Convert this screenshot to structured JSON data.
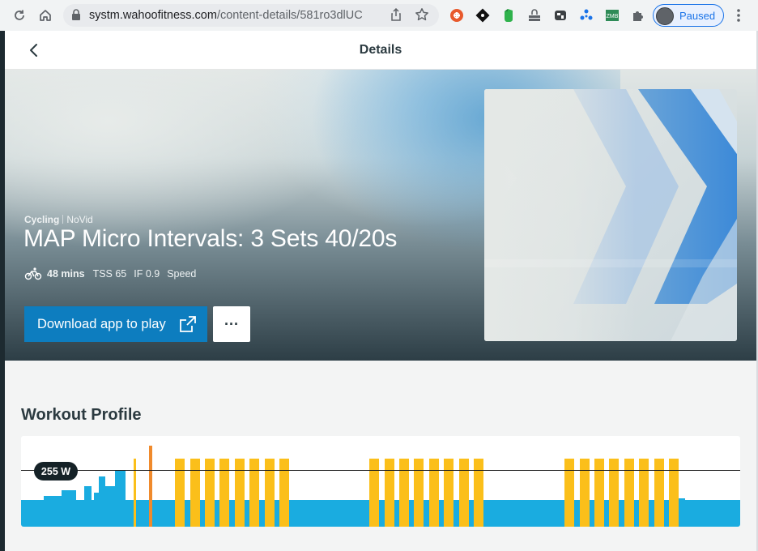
{
  "browser": {
    "url_domain": "systm.wahoofitness.com",
    "url_path": "/content-details/581ro3dlUC",
    "profile_status": "Paused",
    "extensions": [
      "ublock-icon",
      "diamond-icon",
      "evernote-icon",
      "lock-stack-icon",
      "mask-icon",
      "dots-icon",
      "zwift-icon",
      "puzzle-icon"
    ]
  },
  "header": {
    "title": "Details"
  },
  "workout": {
    "sport": "Cycling",
    "tag": "NoVid",
    "title": "MAP Micro Intervals: 3 Sets 40/20s",
    "duration": "48 mins",
    "tss": "TSS 65",
    "if": "IF 0.9",
    "category": "Speed"
  },
  "actions": {
    "download_label": "Download app to play",
    "more_label": "···"
  },
  "profile": {
    "section_title": "Workout Profile",
    "ftp_label": "255 W",
    "colors": {
      "endurance": "#1aace0",
      "interval": "#fbbf1a",
      "peak": "#f08a2c",
      "ftp_line": "#1b1b1b"
    }
  }
}
